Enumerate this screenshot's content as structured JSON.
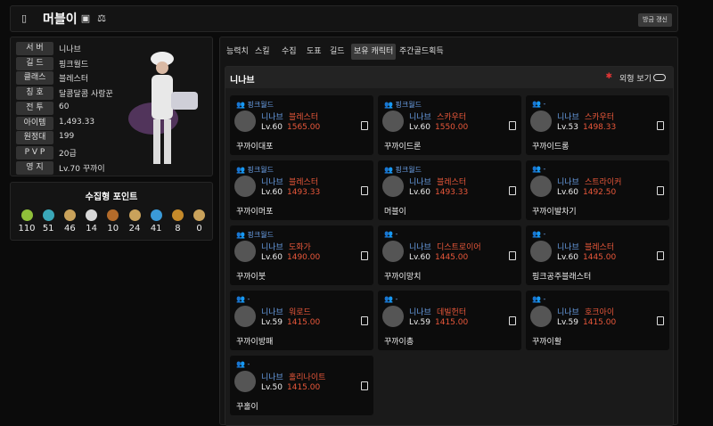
{
  "header": {
    "name": "머블이",
    "refresh_label": "방금 갱신"
  },
  "profile": {
    "rows": [
      {
        "label": "서 버",
        "value": "니나브"
      },
      {
        "label": "길 드",
        "value": "핑크월드"
      },
      {
        "label": "클래스",
        "value": "블레스터"
      },
      {
        "label": "칭 호",
        "value": "달콤달콤 사랑꾼"
      },
      {
        "label": "전 투",
        "value": "60"
      },
      {
        "label": "아이템",
        "value": "1,493.33"
      },
      {
        "label": "원정대",
        "value": "199"
      },
      {
        "label": "P V P",
        "value": "20급"
      },
      {
        "label": "영 지",
        "value": "Lv.70 꾸까이"
      }
    ]
  },
  "points": {
    "title": "수집형 포인트",
    "items": [
      {
        "icon": "seed-icon",
        "count": "110",
        "color": "#8fbf3a"
      },
      {
        "icon": "island-icon",
        "count": "51",
        "color": "#3aa7b8"
      },
      {
        "icon": "map-icon",
        "count": "46",
        "color": "#c9a25b"
      },
      {
        "icon": "heart-icon",
        "count": "14",
        "color": "#d8d8d8"
      },
      {
        "icon": "shield-icon",
        "count": "10",
        "color": "#b36b2a"
      },
      {
        "icon": "orb-icon",
        "count": "24",
        "color": "#c9a25b"
      },
      {
        "icon": "leaf-icon",
        "count": "41",
        "color": "#3a9ad8"
      },
      {
        "icon": "star-icon",
        "count": "8",
        "color": "#c58a2a"
      },
      {
        "icon": "compass-icon",
        "count": "0",
        "color": "#c9a25b"
      }
    ]
  },
  "tabs": [
    "능력치",
    "스킬",
    "수집",
    "도표",
    "길드",
    "보유 캐릭터",
    "주간골드획득"
  ],
  "panel": {
    "server": "니나브",
    "look_label": "외형 보기"
  },
  "characters": [
    {
      "guild": "핑크월드",
      "server": "니나브",
      "class": "블레스터",
      "level": "Lv.60",
      "ilvl": "1565.00",
      "nick": "꾸까이대포"
    },
    {
      "guild": "핑크월드",
      "server": "니나브",
      "class": "스카우터",
      "level": "Lv.60",
      "ilvl": "1550.00",
      "nick": "꾸까이드론"
    },
    {
      "guild": "-",
      "server": "니나브",
      "class": "스카우터",
      "level": "Lv.53",
      "ilvl": "1498.33",
      "nick": "꾸까이드롱"
    },
    {
      "guild": "핑크월드",
      "server": "니나브",
      "class": "블레스터",
      "level": "Lv.60",
      "ilvl": "1493.33",
      "nick": "꾸까이머포"
    },
    {
      "guild": "핑크월드",
      "server": "니나브",
      "class": "블레스터",
      "level": "Lv.60",
      "ilvl": "1493.33",
      "nick": "머블이"
    },
    {
      "guild": "-",
      "server": "니나브",
      "class": "스트라이커",
      "level": "Lv.60",
      "ilvl": "1492.50",
      "nick": "꾸까이발차기"
    },
    {
      "guild": "핑크월드",
      "server": "니나브",
      "class": "도화가",
      "level": "Lv.60",
      "ilvl": "1490.00",
      "nick": "꾸까이붓"
    },
    {
      "guild": "-",
      "server": "니나브",
      "class": "디스트로이어",
      "level": "Lv.60",
      "ilvl": "1445.00",
      "nick": "꾸까이망치"
    },
    {
      "guild": "-",
      "server": "니나브",
      "class": "블레스터",
      "level": "Lv.60",
      "ilvl": "1445.00",
      "nick": "핑크공주블래스터"
    },
    {
      "guild": "-",
      "server": "니나브",
      "class": "워로드",
      "level": "Lv.59",
      "ilvl": "1415.00",
      "nick": "꾸까이방패"
    },
    {
      "guild": "-",
      "server": "니나브",
      "class": "데빌헌터",
      "level": "Lv.59",
      "ilvl": "1415.00",
      "nick": "꾸까이총"
    },
    {
      "guild": "-",
      "server": "니나브",
      "class": "호크아이",
      "level": "Lv.59",
      "ilvl": "1415.00",
      "nick": "꾸까이활"
    },
    {
      "guild": "-",
      "server": "니나브",
      "class": "홀리나이트",
      "level": "Lv.50",
      "ilvl": "1415.00",
      "nick": "꾸홀이"
    }
  ]
}
